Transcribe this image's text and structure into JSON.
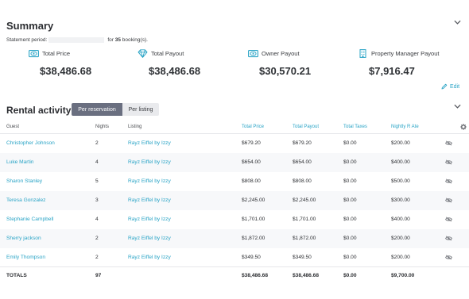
{
  "summary": {
    "title": "Summary",
    "period_label": "Statement period:",
    "period_for": "for",
    "bookings_count": "35",
    "bookings_suffix": "booking(s)."
  },
  "cards": [
    {
      "label": "Total Price",
      "value": "$38,486.68",
      "icon": "wallet-icon"
    },
    {
      "label": "Total Payout",
      "value": "$38,486.68",
      "icon": "diamond-icon"
    },
    {
      "label": "Owner Payout",
      "value": "$30,570.21",
      "icon": "wallet-icon"
    },
    {
      "label": "Property Manager Payout",
      "value": "$7,916.47",
      "icon": "building-icon"
    }
  ],
  "edit_label": "Edit",
  "rental": {
    "title": "Rental activity",
    "tab_per_reservation": "Per reservation",
    "tab_per_listing": "Per listing"
  },
  "columns": [
    "Guest",
    "Nights",
    "Listing",
    "Total Price",
    "Total Payout",
    "Total Taxes",
    "Nightly R Ate"
  ],
  "rows": [
    {
      "guest": "Christopher Johnson",
      "nights": "2",
      "listing": "Rayz Eiffel by Izzy",
      "price": "$679.20",
      "payout": "$679.20",
      "taxes": "$0.00",
      "rate": "$200.00"
    },
    {
      "guest": "Luke Martin",
      "nights": "4",
      "listing": "Rayz Eiffel by Izzy",
      "price": "$654.00",
      "payout": "$654.00",
      "taxes": "$0.00",
      "rate": "$400.00"
    },
    {
      "guest": "Sharon Stanley",
      "nights": "5",
      "listing": "Rayz Eiffel by Izzy",
      "price": "$808.00",
      "payout": "$808.00",
      "taxes": "$0.00",
      "rate": "$500.00"
    },
    {
      "guest": "Teresa Gonzalez",
      "nights": "3",
      "listing": "Rayz Eiffel by Izzy",
      "price": "$2,245.00",
      "payout": "$2,245.00",
      "taxes": "$0.00",
      "rate": "$300.00"
    },
    {
      "guest": "Stephanie Campbell",
      "nights": "4",
      "listing": "Rayz Eiffel by Izzy",
      "price": "$1,701.00",
      "payout": "$1,701.00",
      "taxes": "$0.00",
      "rate": "$400.00"
    },
    {
      "guest": "Sherry jackson",
      "nights": "2",
      "listing": "Rayz Eiffel by Izzy",
      "price": "$1,872.00",
      "payout": "$1,872.00",
      "taxes": "$0.00",
      "rate": "$200.00"
    },
    {
      "guest": "Emily Thompson",
      "nights": "2",
      "listing": "Rayz Eiffel by Izzy",
      "price": "$349.50",
      "payout": "$349.50",
      "taxes": "$0.00",
      "rate": "$200.00"
    }
  ],
  "totals": {
    "label": "TOTALS",
    "nights": "97",
    "price": "$38,486.68",
    "payout": "$38,486.68",
    "taxes": "$0.00",
    "rate": "$9,700.00"
  },
  "colors": {
    "accent": "#2aa4c6",
    "tab_active": "#6a6f80",
    "row_alt": "#f7f8fa"
  }
}
